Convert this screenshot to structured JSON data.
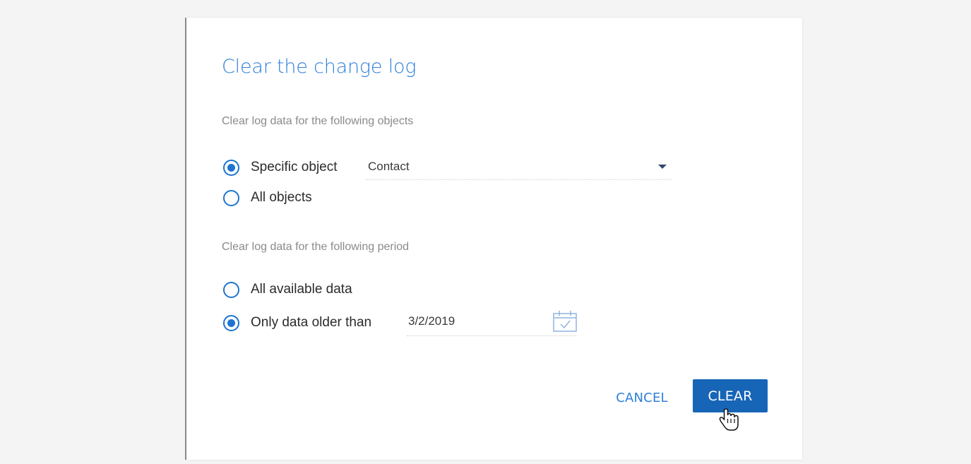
{
  "dialog": {
    "title": "Clear the change log",
    "objects_section": {
      "label": "Clear log data for the following objects",
      "options": [
        {
          "label": "Specific object",
          "checked": true
        },
        {
          "label": "All objects",
          "checked": false
        }
      ],
      "object_select": {
        "value": "Contact",
        "icon": "chevron-down-icon"
      }
    },
    "period_section": {
      "label": "Clear log data for the following period",
      "options": [
        {
          "label": "All available data",
          "checked": false
        },
        {
          "label": "Only data older than",
          "checked": true
        }
      ],
      "date_field": {
        "value": "3/2/2019",
        "icon": "calendar-icon"
      }
    },
    "buttons": {
      "cancel_label": "CANCEL",
      "clear_label": "CLEAR"
    }
  },
  "colors": {
    "accent": "#2f7fd8",
    "radio": "#1d74d0",
    "primary_button": "#1765b7",
    "section_label": "#8a8a8a",
    "background": "#f4f4f4"
  },
  "pointer": {
    "icon": "hand-pointer-icon"
  }
}
